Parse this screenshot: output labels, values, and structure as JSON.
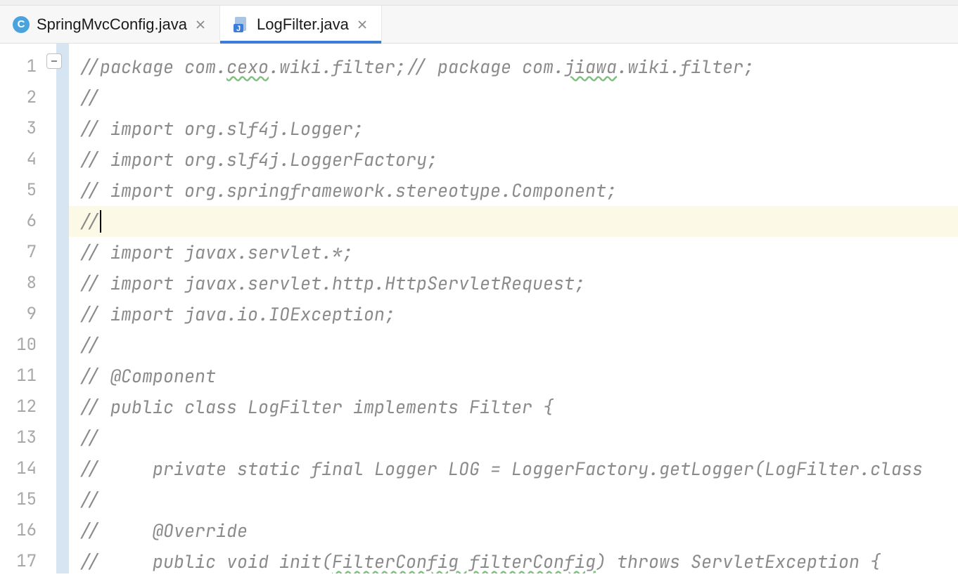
{
  "tabs": [
    {
      "label": "SpringMvcConfig.java",
      "active": false,
      "icon_letter": "C"
    },
    {
      "label": "LogFilter.java",
      "active": true,
      "icon_letter": "J"
    }
  ],
  "lines": [
    {
      "num": "1",
      "content": "//package com.cexo.wiki.filter;// package com.jiawa.wiki.filter;",
      "current": false,
      "typo_ranges": [
        [
          "cexo"
        ],
        [
          "jiawa"
        ]
      ]
    },
    {
      "num": "2",
      "content": "//",
      "current": false
    },
    {
      "num": "3",
      "content": "// import org.slf4j.Logger;",
      "current": false
    },
    {
      "num": "4",
      "content": "// import org.slf4j.LoggerFactory;",
      "current": false
    },
    {
      "num": "5",
      "content": "// import org.springframework.stereotype.Component;",
      "current": false
    },
    {
      "num": "6",
      "content": "//",
      "current": true
    },
    {
      "num": "7",
      "content": "// import javax.servlet.*;",
      "current": false
    },
    {
      "num": "8",
      "content": "// import javax.servlet.http.HttpServletRequest;",
      "current": false
    },
    {
      "num": "9",
      "content": "// import java.io.IOException;",
      "current": false
    },
    {
      "num": "10",
      "content": "//",
      "current": false
    },
    {
      "num": "11",
      "content": "// @Component",
      "current": false
    },
    {
      "num": "12",
      "content": "// public class LogFilter implements Filter {",
      "current": false
    },
    {
      "num": "13",
      "content": "//",
      "current": false
    },
    {
      "num": "14",
      "content": "//     private static final Logger LOG = LoggerFactory.getLogger(LogFilter.class",
      "current": false
    },
    {
      "num": "15",
      "content": "//",
      "current": false
    },
    {
      "num": "16",
      "content": "//     @Override",
      "current": false
    },
    {
      "num": "17",
      "content": "//     public void init(FilterConfig filterConfig) throws ServletException {",
      "current": false,
      "typo_ranges": [
        [
          "FilterConfig filterConfig"
        ]
      ]
    }
  ]
}
